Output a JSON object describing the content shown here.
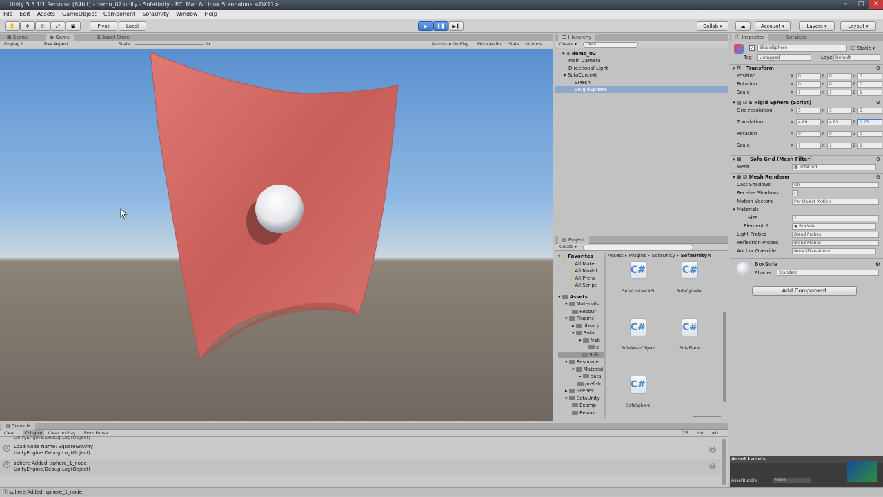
{
  "window": {
    "title": "Unity 5.5.1f1 Personal (64bit) - demo_02.unity - SofaUnity - PC, Mac & Linux Standalone <DX11>"
  },
  "menu": [
    "File",
    "Edit",
    "Assets",
    "GameObject",
    "Component",
    "SofaUnity",
    "Window",
    "Help"
  ],
  "toolbar": {
    "pivot": "Pivot",
    "local": "Local",
    "collab": "Collab ▾",
    "account": "Account",
    "layers": "Layers",
    "layout": "Layout"
  },
  "scene_tabs": {
    "scene": "Scene",
    "game": "Game",
    "asset_store": "Asset Store"
  },
  "game_bar": {
    "display": "Display 1",
    "aspect": "Free Aspect",
    "scale_label": "Scale",
    "scale_value": "1x",
    "maximize": "Maximize On Play",
    "mute": "Mute Audio",
    "stats": "Stats",
    "gizmos": "Gizmos"
  },
  "hierarchy": {
    "tab": "Hierarchy",
    "create": "Create ▾",
    "search": "Q▾All",
    "items": [
      {
        "label": "demo_02",
        "bold": true
      },
      {
        "label": "Main Camera"
      },
      {
        "label": "Directional Light"
      },
      {
        "label": "SofaContext"
      },
      {
        "label": "SMesh"
      },
      {
        "label": "SRigidSphere",
        "selected": true
      }
    ]
  },
  "project": {
    "tab": "Project",
    "create": "Create ▾",
    "favorites": {
      "label": "Favorites",
      "items": [
        "All Materials",
        "All Models",
        "All Prefabs",
        "All Scripts"
      ]
    },
    "favorites_display": [
      "All Materi",
      "All Model",
      "All Prefa",
      "All Script"
    ],
    "assets_label": "Assets",
    "tree": [
      "Materials",
      "Resour",
      "Plugins",
      "library",
      "SofaU",
      "Nati",
      "x",
      "Sofa",
      "Resource",
      "Material",
      "data",
      "prefab",
      "Scenes",
      "SofaUnity",
      "Examp",
      "Resour"
    ],
    "breadcrumb": [
      "Assets",
      "Plugins",
      "SofaUnity",
      "SofaUnityA"
    ],
    "files": [
      "SofaContextAPI",
      "SofaCylinder",
      "SofaMeshObject",
      "SofaPlane",
      "SofaSphere"
    ]
  },
  "inspector": {
    "tab": "Inspector",
    "services_tab": "Services",
    "object_name": "SRigidSphere",
    "static": "Static",
    "tag_label": "Tag",
    "tag": "Untagged",
    "layer_label": "Layer",
    "layer": "Default",
    "transform": {
      "title": "Transform",
      "position_label": "Position",
      "rotation_label": "Rotation",
      "scale_label": "Scale",
      "position": [
        "0",
        "0",
        "0"
      ],
      "rotation": [
        "0",
        "0",
        "0"
      ],
      "scale": [
        "1",
        "1",
        "1"
      ]
    },
    "rigid": {
      "title": "S Rigid Sphere (Script)",
      "grid_label": "Grid resolution",
      "translation_label": "Translation",
      "rotation_label": "Rotation",
      "scale_label": "Scale",
      "grid": [
        "5",
        "5",
        "5"
      ],
      "translation": [
        "4.89",
        "4.83",
        "1.25"
      ],
      "rotation": [
        "0",
        "0",
        "0"
      ],
      "scale": [
        "1",
        "1",
        "1"
      ]
    },
    "mesh_filter": {
      "title": "Sofa Grid (Mesh Filter)",
      "mesh_label": "Mesh",
      "mesh": "SofaGrid"
    },
    "mesh_renderer": {
      "title": "Mesh Renderer",
      "cast_label": "Cast Shadows",
      "cast": "On",
      "receive_label": "Receive Shadows",
      "motion_label": "Motion Vectors",
      "motion": "Per Object Motion",
      "materials_label": "Materials",
      "size_label": "Size",
      "size": "1",
      "element_label": "Element 0",
      "element": "BoxSofa",
      "probes_label": "Light Probes",
      "probes": "Blend Probes",
      "reflection_label": "Reflection Probes",
      "reflection": "Blend Probes",
      "anchor_label": "Anchor Override",
      "anchor": "None (Transform)"
    },
    "material": {
      "name": "BoxSofa",
      "shader_label": "Shader",
      "shader": "Standard"
    },
    "add_component": "Add Component",
    "asset_labels": "Asset Labels",
    "asset_bundle_label": "AssetBundle",
    "asset_bundle": "None"
  },
  "console": {
    "tab": "Console",
    "clear": "Clear",
    "collapse": "Collapse",
    "clear_on_play": "Clear on Play",
    "error_pause": "Error Pause",
    "counts": [
      "5",
      "0",
      "0"
    ],
    "entries": [
      {
        "line1": "Load Node Name: SquareGravity",
        "line2": "UnityEngine.Debug:Log(Object)",
        "count": "1"
      },
      {
        "line1": "sphere Added: sphere_1_node",
        "line2": "UnityEngine.Debug:Log(Object)",
        "count": "1"
      }
    ],
    "partial_top": "UnityEngine.Debug:Log(Object)"
  },
  "status_bar": "sphere Added: sphere_1_node",
  "colors": {
    "accent": "#3f78cc",
    "cloth": "#d4706b",
    "selection": "#8fa8c8"
  }
}
